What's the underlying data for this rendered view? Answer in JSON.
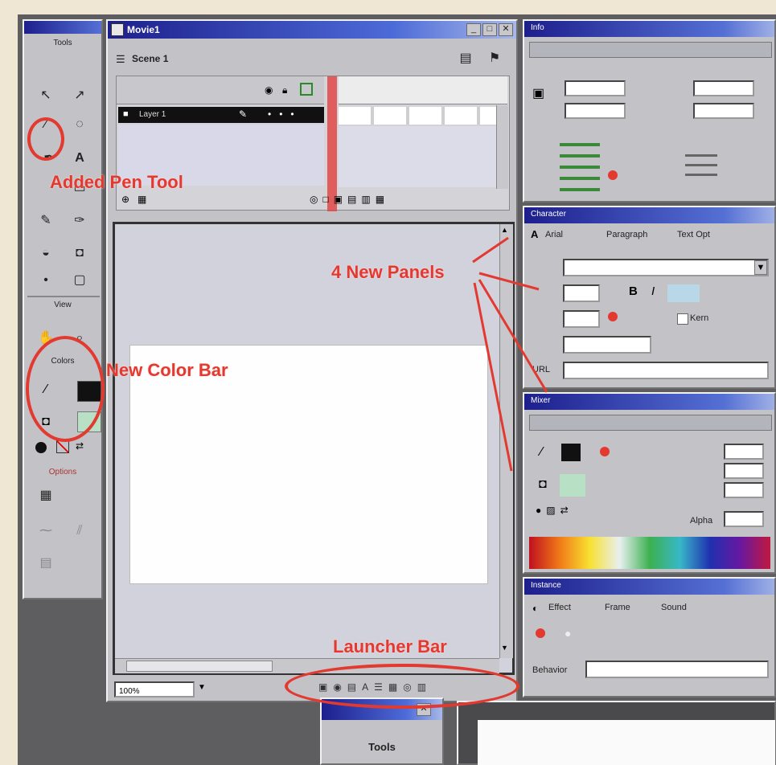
{
  "movie_window": {
    "title": "Movie1",
    "scene_label": "Scene 1",
    "layer_name": "Layer 1",
    "zoom_value": "100%"
  },
  "toolbox": {
    "title": "Tools",
    "view_label": "View",
    "colors_label": "Colors",
    "options_label": "Options"
  },
  "annotations": {
    "pen_tool": "Added Pen Tool",
    "new_panels": "4 New Panels",
    "color_bar": "New Color Bar",
    "launcher_bar": "Launcher Bar"
  },
  "panels": {
    "info": {
      "title": "Info"
    },
    "character": {
      "title": "Character",
      "font_value": "Arial",
      "tabs": [
        "Paragraph",
        "Text Opt"
      ],
      "kern_label": "Kern",
      "url_label": "URL"
    },
    "mixer": {
      "title": "Mixer",
      "alpha_label": "Alpha"
    },
    "instance": {
      "title": "Instance",
      "tabs": [
        "Effect",
        "Frame",
        "Sound"
      ],
      "behavior_label": "Behavior"
    }
  },
  "bottom_toolbox": {
    "title": "Tools"
  },
  "colors": {
    "annotation": "#e23a30",
    "titlebar_start": "#1d1f8c",
    "titlebar_end": "#a8b8e8",
    "panel_gray": "#c3c3c7"
  }
}
